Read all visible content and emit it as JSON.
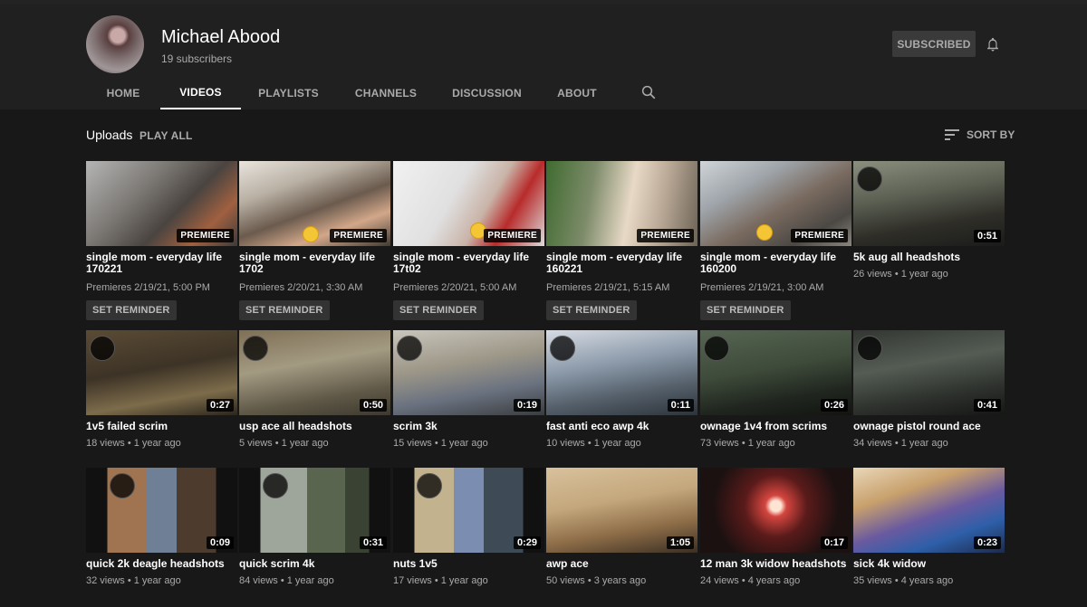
{
  "channel": {
    "name": "Michael Abood",
    "subscribers": "19 subscribers",
    "subscribe_label": "SUBSCRIBED"
  },
  "tabs": [
    {
      "label": "HOME"
    },
    {
      "label": "VIDEOS"
    },
    {
      "label": "PLAYLISTS"
    },
    {
      "label": "CHANNELS"
    },
    {
      "label": "DISCUSSION"
    },
    {
      "label": "ABOUT"
    }
  ],
  "section": {
    "title": "Uploads",
    "play_all": "PLAY ALL",
    "sort_by": "SORT BY"
  },
  "icons": {
    "bell": "bell-icon",
    "search": "search-icon",
    "sort": "sort-icon"
  },
  "videos": [
    {
      "title": "single mom - everyday life 170221",
      "badge": "PREMIERE",
      "meta": "Premieres 2/19/21, 5:00 PM",
      "reminder": "SET REMINDER"
    },
    {
      "title": "single mom - everyday life 1702",
      "badge": "PREMIERE",
      "meta": "Premieres 2/20/21, 3:30 AM",
      "reminder": "SET REMINDER"
    },
    {
      "title": "single mom - everyday life 17t02",
      "badge": "PREMIERE",
      "meta": "Premieres 2/20/21, 5:00 AM",
      "reminder": "SET REMINDER"
    },
    {
      "title": "single mom - everyday life 160221",
      "badge": "PREMIERE",
      "meta": "Premieres 2/19/21, 5:15 AM",
      "reminder": "SET REMINDER"
    },
    {
      "title": "single mom - everyday life 160200",
      "badge": "PREMIERE",
      "meta": "Premieres 2/19/21, 3:00 AM",
      "reminder": "SET REMINDER"
    },
    {
      "title": "5k aug all headshots",
      "badge": "0:51",
      "meta": "26 views • 1 year ago"
    },
    {
      "title": "1v5 failed scrim",
      "badge": "0:27",
      "meta": "18 views • 1 year ago"
    },
    {
      "title": "usp ace all headshots",
      "badge": "0:50",
      "meta": "5 views • 1 year ago"
    },
    {
      "title": "scrim 3k",
      "badge": "0:19",
      "meta": "15 views • 1 year ago"
    },
    {
      "title": "fast anti eco awp 4k",
      "badge": "0:11",
      "meta": "10 views • 1 year ago"
    },
    {
      "title": "ownage 1v4 from scrims",
      "badge": "0:26",
      "meta": "73 views • 1 year ago"
    },
    {
      "title": "ownage pistol round ace",
      "badge": "0:41",
      "meta": "34 views • 1 year ago"
    },
    {
      "title": "quick 2k deagle headshots",
      "badge": "0:09",
      "meta": "32 views • 1 year ago"
    },
    {
      "title": "quick scrim 4k",
      "badge": "0:31",
      "meta": "84 views • 1 year ago"
    },
    {
      "title": "nuts 1v5",
      "badge": "0:29",
      "meta": "17 views • 1 year ago"
    },
    {
      "title": "awp ace",
      "badge": "1:05",
      "meta": "50 views • 3 years ago"
    },
    {
      "title": "12 man 3k widow headshots",
      "badge": "0:17",
      "meta": "24 views • 4 years ago"
    },
    {
      "title": "sick 4k widow",
      "badge": "0:23",
      "meta": "35 views • 4 years ago"
    }
  ]
}
